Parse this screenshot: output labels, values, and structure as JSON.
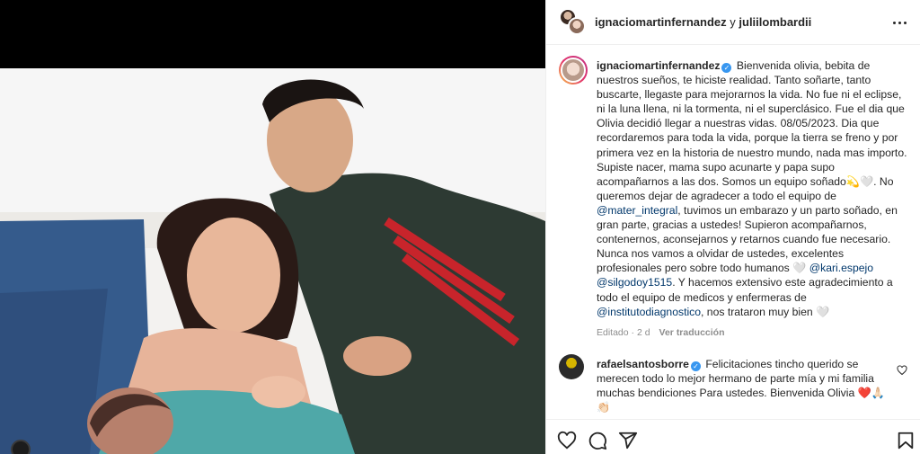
{
  "header": {
    "user1": "ignaciomartinfernandez",
    "joiner": "y",
    "user2": "juliilombardii"
  },
  "post": {
    "username": "ignaciomartinfernandez",
    "text_1": "Bienvenida olivia, bebita de nuestros sueños, te hiciste realidad. Tanto soñarte, tanto buscarte, llegaste para mejorarnos la vida. No fue ni el eclipse, ni la luna llena, ni la tormenta, ni el superclásico. Fue el dia que Olivia decidió llegar a nuestras vidas. 08/05/2023. Dia que recordaremos para toda la vida, porque la tierra se freno y por primera vez en la historia de nuestro mundo, nada mas importo.",
    "text_2": "Supiste nacer, mama supo acunarte y papa supo acompañarnos a las dos. Somos un equipo soñado💫🤍. No queremos dejar de agradecer a todo el equipo de",
    "mention_1": "@mater_integral",
    "text_3": ", tuvimos un embarazo y un parto soñado, en gran parte, gracias a ustedes! Supieron acompañarnos, contenernos, aconsejarnos y retarnos cuando fue necesario. Nunca nos vamos a olvidar de ustedes, excelentes profesionales pero sobre todo humanos 🤍",
    "mention_2": "@kari.espejo",
    "mention_3": "@silgodoy1515",
    "text_4": ". Y hacemos extensivo este agradecimiento a todo el equipo de medicos y enfermeras de",
    "mention_4": "@institutodiagnostico",
    "text_5": ", nos trataron muy bien 🤍",
    "meta_edited": "Editado · 2 d",
    "meta_translate": "Ver traducción"
  },
  "comment": {
    "username": "rafaelsantosborre",
    "text": "Felicitaciones tincho querido se merecen todo lo mejor hermano de parte mía y mi familia muchas bendiciones Para ustedes. Bienvenida Olivia ❤️🙏🏻👏🏻"
  },
  "icons": {
    "more": "more-options-icon",
    "verified": "verified-badge-icon",
    "like": "heart-icon",
    "comment": "comment-icon",
    "share": "share-icon",
    "save": "bookmark-icon"
  },
  "colors": {
    "verified": "#3897f0",
    "mention": "#00376b",
    "meta": "#8e8e8e"
  }
}
